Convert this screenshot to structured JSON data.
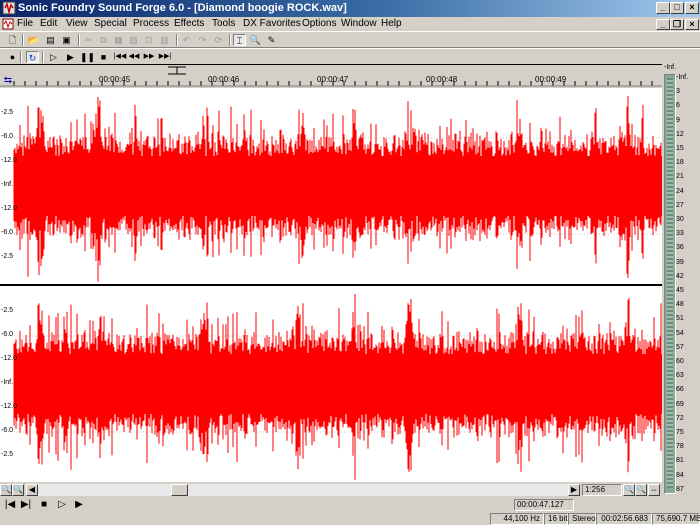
{
  "window": {
    "title": "Sonic Foundry Sound Forge 6.0 - [Diamond boogie ROCK.wav]",
    "minimize_label": "_",
    "maximize_label": "□",
    "close_label": "×",
    "doc_minimize_label": "_",
    "doc_restore_label": "❐",
    "doc_close_label": "×"
  },
  "menu": [
    "File",
    "Edit",
    "View",
    "Special",
    "Process",
    "Effects",
    "Tools",
    "DX Favorites",
    "Options",
    "Window",
    "Help"
  ],
  "toolbar1": [
    {
      "name": "new-icon",
      "glyph": "🗋",
      "enabled": true
    },
    {
      "name": "open-icon",
      "glyph": "📂",
      "enabled": true
    },
    {
      "name": "save-as-icon",
      "glyph": "▤",
      "enabled": true
    },
    {
      "name": "save-icon",
      "glyph": "▣",
      "enabled": true
    },
    {
      "name": "cut-icon",
      "glyph": "✂",
      "enabled": false
    },
    {
      "name": "copy-icon",
      "glyph": "⧉",
      "enabled": false
    },
    {
      "name": "paste-icon",
      "glyph": "▦",
      "enabled": false
    },
    {
      "name": "mix-icon",
      "glyph": "▧",
      "enabled": false
    },
    {
      "name": "crop-icon",
      "glyph": "⊡",
      "enabled": false
    },
    {
      "name": "trim-icon",
      "glyph": "▥",
      "enabled": false
    },
    {
      "name": "undo-icon",
      "glyph": "↶",
      "enabled": false
    },
    {
      "name": "redo-icon",
      "glyph": "↷",
      "enabled": false
    },
    {
      "name": "repeat-icon",
      "glyph": "⟳",
      "enabled": false
    },
    {
      "name": "edit-tool-icon",
      "glyph": "⌶",
      "enabled": true
    },
    {
      "name": "magnify-tool-icon",
      "glyph": "🔍",
      "enabled": true
    },
    {
      "name": "pencil-tool-icon",
      "glyph": "✎",
      "enabled": true
    }
  ],
  "transport": [
    {
      "name": "record-icon",
      "glyph": "●"
    },
    {
      "name": "loop-playback-icon",
      "glyph": "↻"
    },
    {
      "name": "play-all-icon",
      "glyph": "▷"
    },
    {
      "name": "play-icon",
      "glyph": "▶"
    },
    {
      "name": "pause-icon",
      "glyph": "❚❚"
    },
    {
      "name": "stop-icon",
      "glyph": "■"
    },
    {
      "name": "go-to-start-icon",
      "glyph": "|◀◀"
    },
    {
      "name": "rewind-icon",
      "glyph": "◀◀"
    },
    {
      "name": "forward-icon",
      "glyph": "▶▶"
    },
    {
      "name": "go-to-end-icon",
      "glyph": "▶▶|"
    }
  ],
  "ruler_ticks": [
    "00:00:45",
    "00:00:46",
    "00:00:47",
    "00:00:48",
    "00:00:49"
  ],
  "channel_scale": [
    "-2.5",
    "-6.0",
    "-12.0",
    "-Inf.",
    "-12.0",
    "-6.0",
    "-2.5"
  ],
  "meter_scale": [
    "-Inf.",
    "3",
    "6",
    "9",
    "12",
    "15",
    "18",
    "21",
    "24",
    "27",
    "30",
    "33",
    "36",
    "39",
    "42",
    "45",
    "48",
    "51",
    "54",
    "57",
    "60",
    "63",
    "66",
    "69",
    "72",
    "75",
    "78",
    "81",
    "84",
    "87"
  ],
  "meter_top_label": "-Inf.",
  "zoom_ratio": "1:256",
  "cursor_position": "00:00:47.127",
  "status": {
    "sample_rate": "44,100 Hz",
    "bit_depth": "16 bit",
    "channels": "Stereo",
    "length": "00:02:56.683",
    "free_space": "75,690.7 MB"
  },
  "colors": {
    "waveform": "#ff0000",
    "background": "#ffffff",
    "title_bar_start": "#0a246a",
    "title_bar_end": "#a6caf0"
  }
}
